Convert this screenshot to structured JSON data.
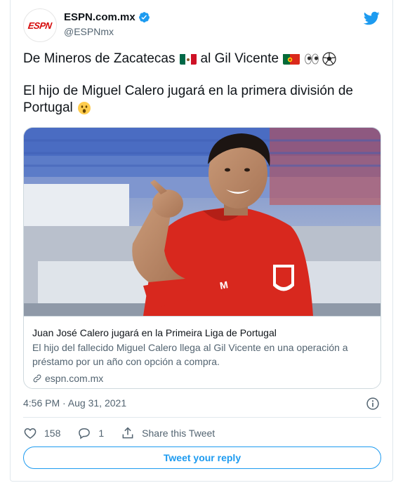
{
  "author": {
    "display_name": "ESPN.com.mx",
    "handle": "@ESPNmx",
    "avatar_text": "ESPN",
    "verified": true
  },
  "tweet": {
    "line1_part1": "De Mineros de Zacatecas",
    "line1_part2": "al Gil Vicente",
    "line2": "El hijo de Miguel Calero jugará en la primera división de",
    "line3": "Portugal",
    "emojis": [
      "mexico-flag",
      "portugal-flag",
      "eyes",
      "soccer-ball",
      "astonished-face"
    ]
  },
  "link_card": {
    "title": "Juan José Calero jugará en la Primeira Liga de Portugal",
    "description": "El hijo del fallecido Miguel Calero llega al Gil Vicente en una operación a préstamo por un año con opción a compra.",
    "domain": "espn.com.mx",
    "image_alt": "player-in-red-jersey-pointing"
  },
  "timestamp": "4:56 PM · Aug 31, 2021",
  "actions": {
    "likes": "158",
    "replies": "1",
    "share_label": "Share this Tweet"
  },
  "reply_button_label": "Tweet your reply",
  "colors": {
    "brand": "#1d9bf0",
    "espn_red": "#d50a0a",
    "jersey_red": "#d8281e"
  }
}
